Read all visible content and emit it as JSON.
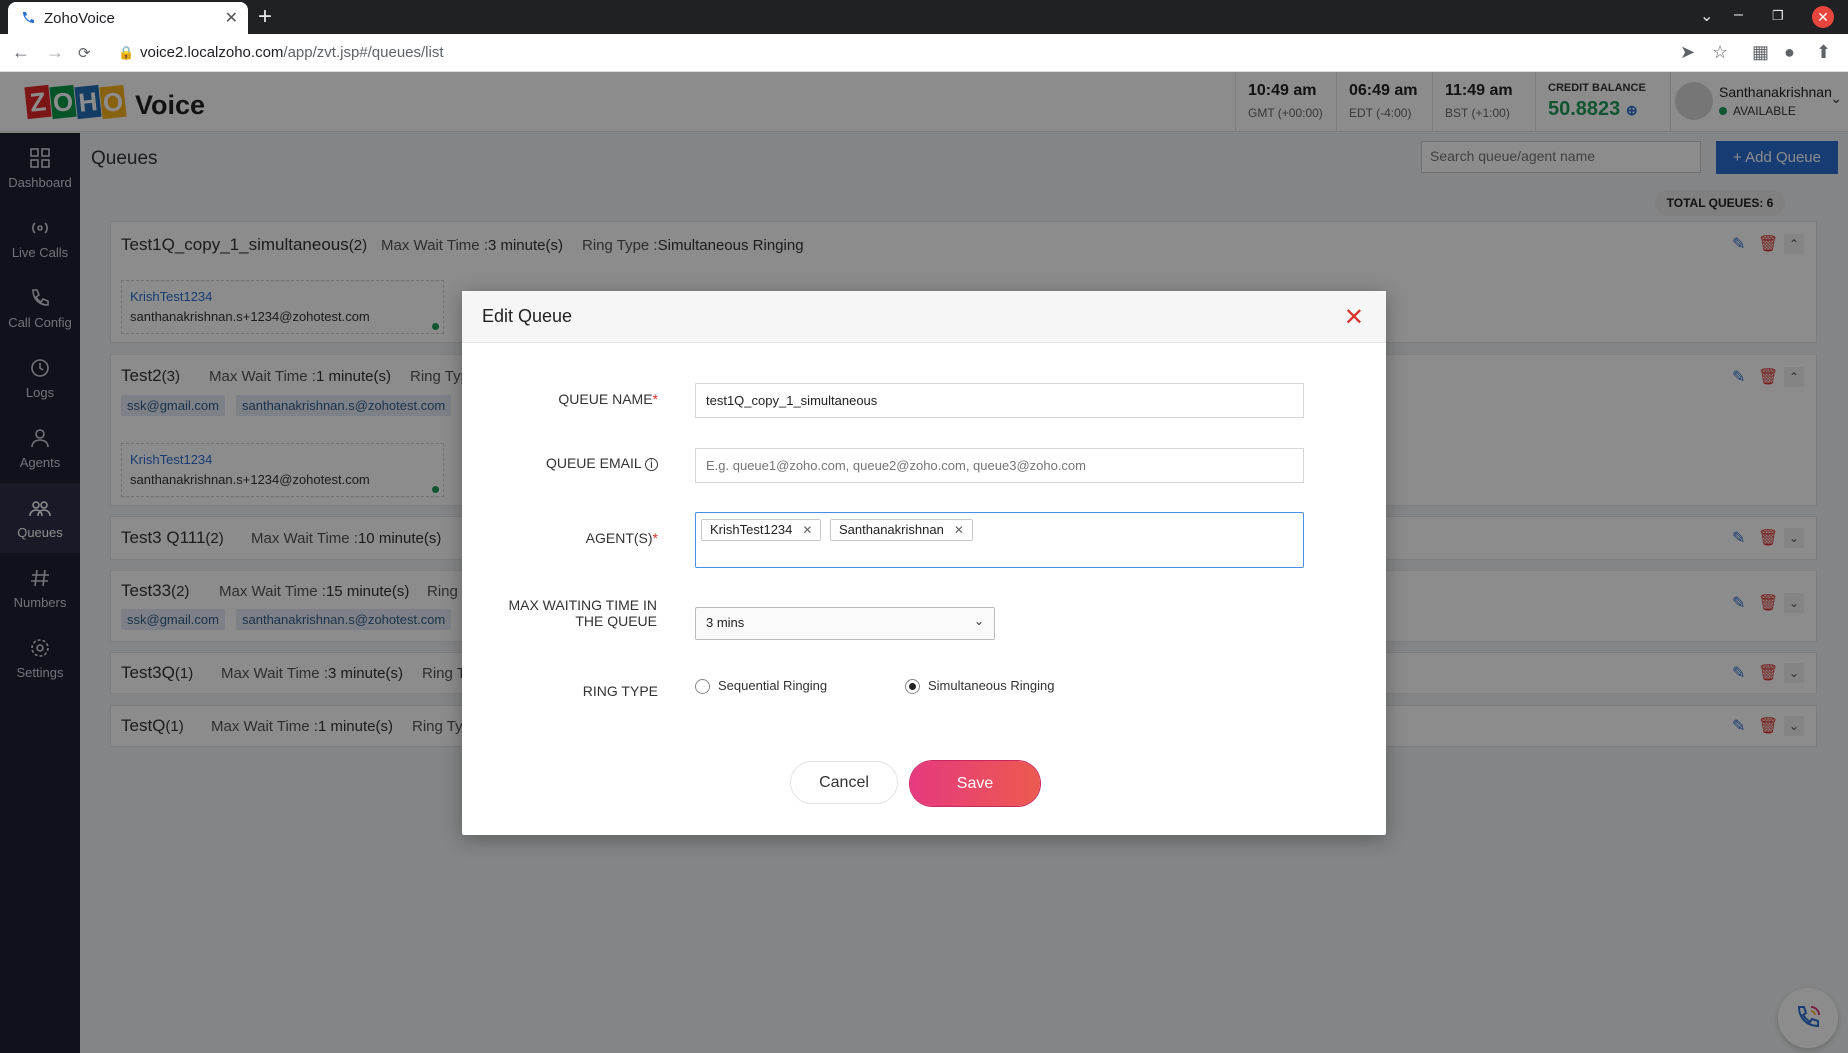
{
  "browser": {
    "tab_title": "ZohoVoice",
    "url_host": "voice2.localzoho.com",
    "url_path": "/app/zvt.jsp#/queues/list"
  },
  "header": {
    "brand": "Voice",
    "clocks": [
      {
        "time": "10:49 am",
        "zone": "GMT (+00:00)"
      },
      {
        "time": "06:49 am",
        "zone": "EDT (-4:00)"
      },
      {
        "time": "11:49 am",
        "zone": "BST (+1:00)"
      }
    ],
    "credit_label": "CREDIT BALANCE",
    "credit_value": "50.8823",
    "user_name": "Santhanakrishnan",
    "user_status": "AVAILABLE"
  },
  "sidebar": {
    "items": [
      {
        "label": "Dashboard",
        "icon": "grid-icon"
      },
      {
        "label": "Live Calls",
        "icon": "broadcast-icon"
      },
      {
        "label": "Call Config",
        "icon": "phone-icon"
      },
      {
        "label": "Logs",
        "icon": "history-icon"
      },
      {
        "label": "Agents",
        "icon": "user-icon"
      },
      {
        "label": "Queues",
        "icon": "users-icon",
        "active": true
      },
      {
        "label": "Numbers",
        "icon": "hash-icon"
      },
      {
        "label": "Settings",
        "icon": "gear-icon"
      }
    ]
  },
  "page": {
    "title": "Queues",
    "search_placeholder": "Search queue/agent name",
    "add_button": "+ Add Queue",
    "total": "TOTAL QUEUES: 6"
  },
  "queues": [
    {
      "name": "Test1Q_copy_1_simultaneous",
      "count": "(2)",
      "wait": "Max Wait Time :",
      "wait_val": "3 minute(s)",
      "ring": "Ring Type :",
      "ring_val": "Simultaneous Ringing",
      "agent_name": "KrishTest1234",
      "agent_email": "santhanakrishnan.s+1234@zohotest.com"
    },
    {
      "name": "Test2",
      "count": "(3)",
      "wait": "Max Wait Time :",
      "wait_val": "1 minute(s)",
      "ring": "Ring Typ",
      "emails": [
        "ssk@gmail.com",
        "santhanakrishnan.s@zohotest.com"
      ],
      "agent_name": "KrishTest1234",
      "agent_email": "santhanakrishnan.s+1234@zohotest.com"
    },
    {
      "name": "Test3 Q111",
      "count": "(2)",
      "wait": "Max Wait Time :",
      "wait_val": "10 minute(s)"
    },
    {
      "name": "Test33",
      "count": "(2)",
      "wait": "Max Wait Time :",
      "wait_val": "15 minute(s)",
      "ring": "Ring T",
      "emails": [
        "ssk@gmail.com",
        "santhanakrishnan.s@zohotest.com"
      ]
    },
    {
      "name": "Test3Q",
      "count": "(1)",
      "wait": "Max Wait Time :",
      "wait_val": "3 minute(s)",
      "ring": "Ring Ty"
    },
    {
      "name": "TestQ",
      "count": "(1)",
      "wait": "Max Wait Time :",
      "wait_val": "1 minute(s)",
      "ring": "Ring Typ"
    }
  ],
  "modal": {
    "title": "Edit Queue",
    "queue_name_label": "QUEUE NAME",
    "queue_name_value": "test1Q_copy_1_simultaneous",
    "queue_email_label": "QUEUE EMAIL",
    "queue_email_placeholder": "E.g. queue1@zoho.com, queue2@zoho.com, queue3@zoho.com",
    "agents_label": "AGENT(S)",
    "agents": [
      "KrishTest1234",
      "Santhanakrishnan"
    ],
    "max_wait_label": "MAX WAITING TIME IN THE QUEUE",
    "max_wait_value": "3 mins",
    "ring_type_label": "RING TYPE",
    "ring_options": [
      "Sequential Ringing",
      "Simultaneous Ringing"
    ],
    "ring_selected": "Simultaneous Ringing",
    "cancel": "Cancel",
    "save": "Save"
  },
  "colors": {
    "accent": "#2a6ed1",
    "sidebar": "#1d2032",
    "save": "#e6397f",
    "credit": "#1e9b5a"
  }
}
